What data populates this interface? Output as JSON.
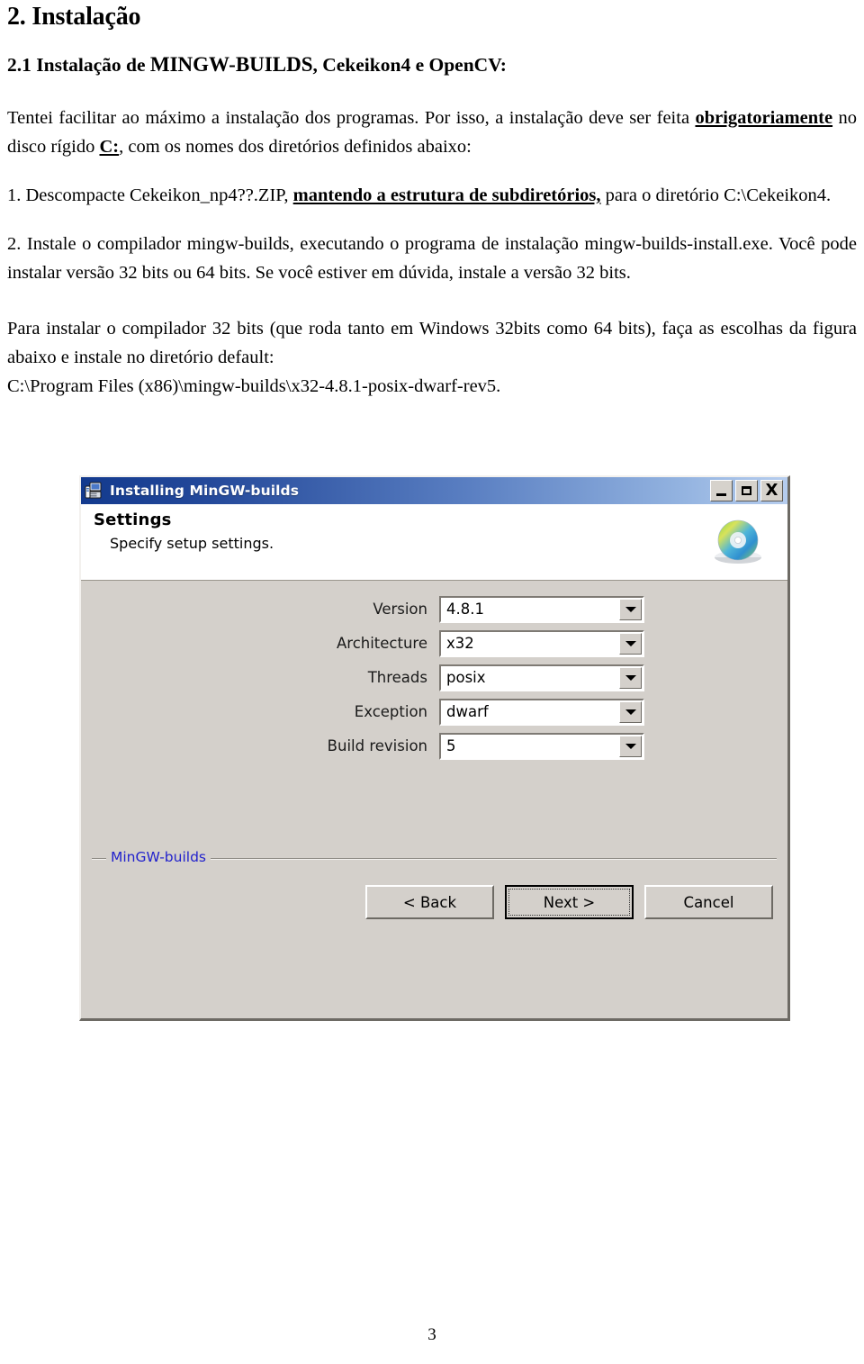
{
  "document": {
    "section_heading": "2. Instalação",
    "subsection_heading_prefix": "2.1 Instalação de ",
    "subsection_heading_caps": "MINGW-BUILDS",
    "subsection_heading_suffix": ", Cekeikon4 e OpenCV:",
    "para1_part1": "Tentei facilitar ao máximo a instalação dos programas. Por isso, a instalação deve ser feita ",
    "para1_emph": "obrigatoriamente",
    "para1_part2": " no disco rígido ",
    "para1_emph2": "C:",
    "para1_part3": ", com os nomes dos diretórios definidos abaixo:",
    "item1_part1": "1. Descompacte Cekeikon_np4??.ZIP, ",
    "item1_emph": "mantendo a estrutura de subdiretórios,",
    "item1_part2": " para o diretório C:\\Cekeikon4.",
    "item2": "2. Instale o compilador mingw-builds, executando o programa de instalação mingw-builds-install.exe. Você pode instalar versão 32 bits ou 64 bits. Se você estiver em dúvida, instale a versão 32 bits.",
    "para3_line1": "Para instalar o compilador 32 bits (que roda tanto em Windows 32bits como 64 bits), faça as escolhas da figura abaixo e instale no diretório default:",
    "para3_line2": "C:\\Program Files (x86)\\mingw-builds\\x32-4.8.1-posix-dwarf-rev5.",
    "page_number": "3"
  },
  "installer_dialog": {
    "window_title": "Installing MinGW-builds",
    "title_icon": "installer-computer-icon",
    "window_buttons": [
      {
        "name": "minimize",
        "glyph": "minimize-icon"
      },
      {
        "name": "maximize",
        "glyph": "maximize-icon"
      },
      {
        "name": "close",
        "glyph": "close-icon",
        "label": "X"
      }
    ],
    "header": {
      "title": "Settings",
      "subtitle": "Specify setup settings.",
      "icon": "cd-disc-icon"
    },
    "fields": [
      {
        "label": "Version",
        "value": "4.8.1"
      },
      {
        "label": "Architecture",
        "value": "x32"
      },
      {
        "label": "Threads",
        "value": "posix"
      },
      {
        "label": "Exception",
        "value": "dwarf"
      },
      {
        "label": "Build revision",
        "value": "5"
      }
    ],
    "group_label": "MinGW-builds",
    "buttons": {
      "back": {
        "label": "< Back",
        "accel": "B",
        "default": false
      },
      "next": {
        "label": "Next >",
        "accel": "N",
        "default": true
      },
      "cancel": {
        "label": "Cancel",
        "accel": "C",
        "default": false
      }
    },
    "colors": {
      "titlebar_start": "#133a8e",
      "titlebar_end": "#b6cdee",
      "dialog_face": "#d4d0cb",
      "header_bg": "#ffffff",
      "group_label": "#2222cc"
    }
  }
}
